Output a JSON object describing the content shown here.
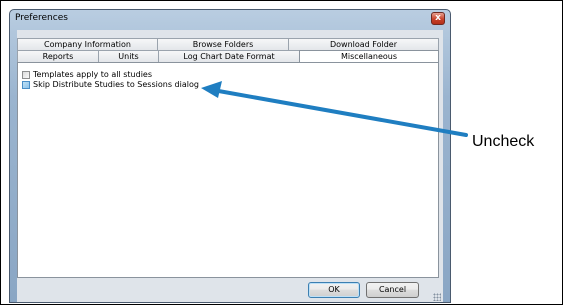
{
  "window": {
    "title": "Preferences",
    "close_glyph": "x"
  },
  "tabs": {
    "back_row": [
      {
        "label": "Company Information"
      },
      {
        "label": "Browse Folders"
      },
      {
        "label": "Download Folder"
      }
    ],
    "front_row": [
      {
        "label": "Reports"
      },
      {
        "label": "Units"
      },
      {
        "label": "Log Chart Date Format"
      },
      {
        "label": "Miscellaneous",
        "active": true
      }
    ]
  },
  "options": [
    {
      "label": "Templates apply to all studies",
      "checked": false
    },
    {
      "label": "Skip Distribute Studies to Sessions dialog",
      "checked": true
    }
  ],
  "buttons": {
    "ok": "OK",
    "cancel": "Cancel"
  },
  "annotation": {
    "text": "Uncheck",
    "arrow_color": "#1f7ec1"
  },
  "colors": {
    "accent": "#1f7ec1",
    "window_frame": "#9ab4cf",
    "close_button": "#c8432c"
  }
}
